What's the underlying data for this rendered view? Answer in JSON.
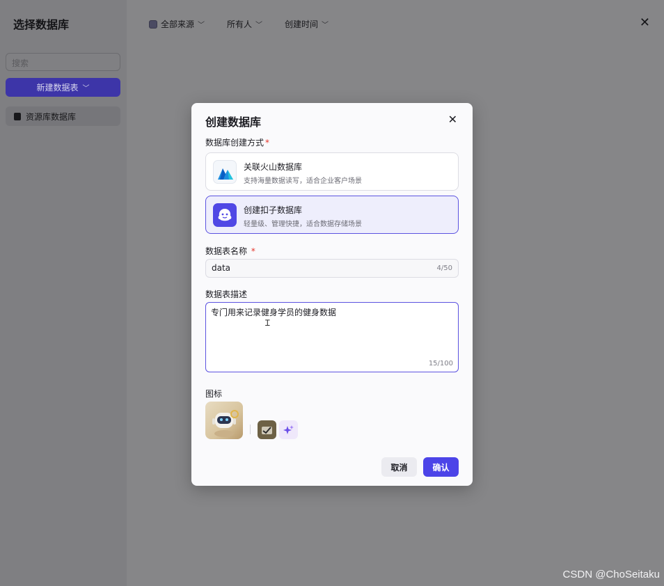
{
  "page": {
    "title": "选择数据库",
    "close_icon": "close-icon"
  },
  "sidebar": {
    "search_placeholder": "搜索",
    "new_table_label": "新建数据表",
    "items": [
      {
        "label": "资源库数据库",
        "icon": "database-icon"
      }
    ]
  },
  "filters": [
    {
      "label": "全部来源"
    },
    {
      "label": "所有人"
    },
    {
      "label": "创建时间"
    }
  ],
  "modal": {
    "title": "创建数据库",
    "method_label": "数据库创建方式",
    "required_mark": "*",
    "options": [
      {
        "title": "关联火山数据库",
        "desc": "支持海量数据读写，适合企业客户场景",
        "selected": false
      },
      {
        "title": "创建扣子数据库",
        "desc": "轻量级、管理快捷，适合数据存储场景",
        "selected": true
      }
    ],
    "name_label": "数据表名称",
    "name_value": "data",
    "name_count": "4/50",
    "desc_label": "数据表描述",
    "desc_value": "专门用来记录健身学员的健身数据",
    "desc_count": "15/100",
    "icon_label": "图标",
    "cancel_label": "取消",
    "confirm_label": "确认"
  },
  "colors": {
    "accent": "#4c44e8",
    "required": "#e5352b"
  },
  "watermark": "CSDN @ChoSeitaku"
}
